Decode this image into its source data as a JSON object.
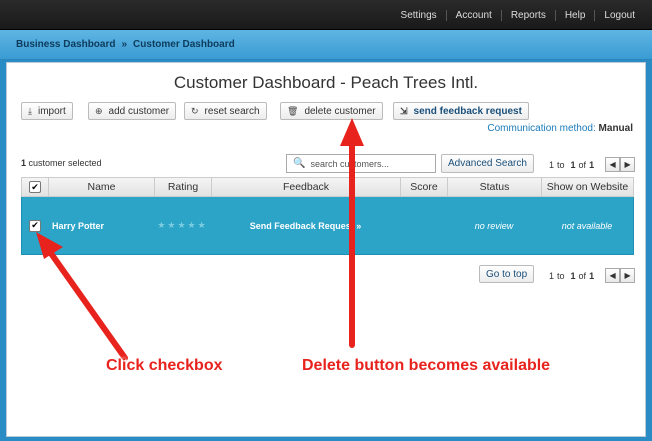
{
  "topnav": [
    "Settings",
    "Account",
    "Reports",
    "Help",
    "Logout"
  ],
  "breadcrumb": {
    "items": [
      "Business Dashboard",
      "Customer Dashboard"
    ],
    "separator": "»"
  },
  "page_title": "Customer Dashboard - Peach Trees Intl.",
  "toolbar": {
    "import": {
      "label": "import",
      "icon": "download-icon"
    },
    "add_customer": {
      "label": "add customer",
      "icon": "plus-circle-icon"
    },
    "reset_search": {
      "label": "reset search",
      "icon": "refresh-icon"
    },
    "delete_customer": {
      "label": "delete customer",
      "icon": "trash-icon"
    },
    "send_feedback": {
      "label": "send feedback request",
      "icon": "share-icon"
    }
  },
  "communication": {
    "label": "Communication method:",
    "value": "Manual"
  },
  "selection": {
    "count": "1",
    "text": "customer selected"
  },
  "search": {
    "placeholder": "search customers..."
  },
  "advanced_search": "Advanced Search",
  "pager": {
    "from": "1",
    "to_word": "to",
    "to": "1",
    "of_word": "of",
    "total": "1"
  },
  "table": {
    "headers": [
      "Name",
      "Rating",
      "Feedback",
      "Score",
      "Status",
      "Show on Website"
    ],
    "rows": [
      {
        "checked": true,
        "name": "Harry Potter",
        "rating": "★★★★★",
        "feedback": "Send Feedback Request »",
        "score": "",
        "status": "no review",
        "website": "not available"
      }
    ]
  },
  "go_to_top": "Go to top",
  "annotations": {
    "click_checkbox": "Click checkbox",
    "delete_available": "Delete button becomes available"
  },
  "colors": {
    "selected_row": "#2ca4c8",
    "annotation": "#e8231d",
    "topbar": "#1f1f1f",
    "crumbbar": "#4aa8dc"
  }
}
